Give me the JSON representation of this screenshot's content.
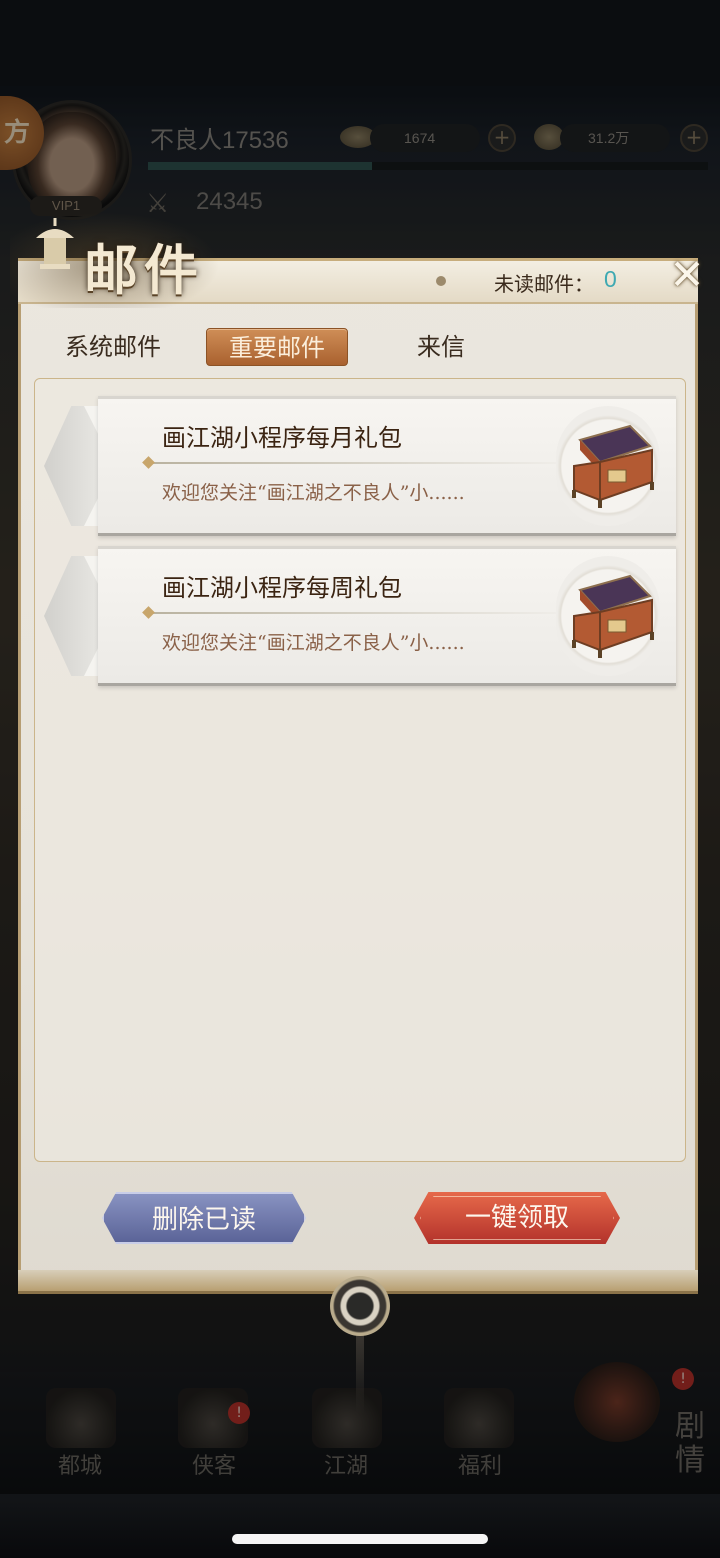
{
  "hud": {
    "side_badge": "方",
    "vip": "VIP1",
    "player_name": "不良人17536",
    "currency_ingot": "1674",
    "currency_coin": "31.2万",
    "plus": "+",
    "power": "24345",
    "exp_progress": 0.4
  },
  "dialog": {
    "title": "邮件",
    "unread_label": "未读邮件：",
    "unread_count": "0",
    "close_icon": "close-icon",
    "tabs": [
      {
        "label": "系统邮件",
        "active": false
      },
      {
        "label": "重要邮件",
        "active": true
      },
      {
        "label": "来信",
        "active": false
      }
    ],
    "mails": [
      {
        "title": "画江湖小程序每月礼包",
        "preview": "欢迎您关注“画江湖之不良人”小......",
        "icon": "treasure-chest-icon"
      },
      {
        "title": "画江湖小程序每周礼包",
        "preview": "欢迎您关注“画江湖之不良人”小......",
        "icon": "treasure-chest-icon"
      }
    ],
    "delete_read_label": "删除已读",
    "claim_all_label": "一键领取"
  },
  "nav": {
    "items": [
      {
        "label": "都城",
        "icon": "city-icon",
        "alert": false
      },
      {
        "label": "侠客",
        "icon": "hero-icon",
        "alert": true
      },
      {
        "label": "江湖",
        "icon": "jianghu-icon",
        "alert": false
      },
      {
        "label": "福利",
        "icon": "welfare-bag-icon",
        "alert": false
      }
    ],
    "story_label": "剧情",
    "alert_mark": "!"
  },
  "colors": {
    "active_tab": "#c07a43",
    "unread_count": "#3fa9b2",
    "delete_button": "#6f79ad",
    "claim_button": "#d04e38",
    "mail_title": "#3b2412",
    "mail_preview": "#8a6148"
  }
}
